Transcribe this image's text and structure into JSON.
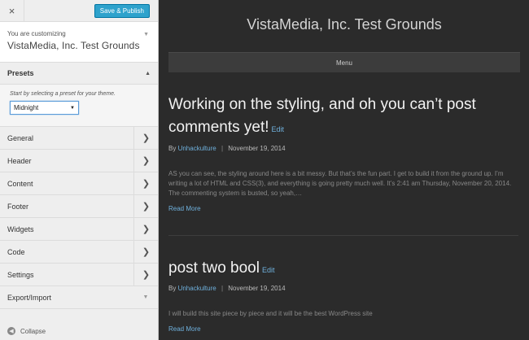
{
  "toolbar": {
    "close_icon": "×",
    "save_label": "Save & Publish"
  },
  "customizing": {
    "label": "You are customizing",
    "site_name": "VistaMedia, Inc. Test Grounds"
  },
  "presets": {
    "title": "Presets",
    "hint": "Start by selecting a preset for your theme.",
    "selected": "Midnight"
  },
  "sections": [
    {
      "label": "General"
    },
    {
      "label": "Header"
    },
    {
      "label": "Content"
    },
    {
      "label": "Footer"
    },
    {
      "label": "Widgets"
    },
    {
      "label": "Code"
    },
    {
      "label": "Settings"
    },
    {
      "label": "Export/Import"
    }
  ],
  "collapse_label": "Collapse",
  "preview": {
    "site_title": "VistaMedia, Inc. Test Grounds",
    "menu_label": "Menu",
    "posts": [
      {
        "title": "Working on the styling, and oh you can’t post comments yet!",
        "edit": "Edit",
        "by": "By",
        "author": "Unhackulture",
        "separator": "|",
        "date": "November 19, 2014",
        "excerpt": "AS you can see, the styling around here is a bit messy. But that’s the fun part. I get to build it from the ground up. I’m writing a lot of HTML and CSS(3), and everything is going pretty much well. It’s 2:41 am Thursday, November 20, 2014. The commenting system is busted, so yeah,…",
        "read_more": "Read More"
      },
      {
        "title": "post two bool",
        "edit": "Edit",
        "by": "By",
        "author": "Unhackulture",
        "separator": "|",
        "date": "November 19, 2014",
        "excerpt": "I will  build this site piece by piece and it will be the best  WordPress site",
        "read_more": "Read More"
      }
    ]
  },
  "colors": {
    "accent": "#2ea2cc",
    "link": "#6fb0dc",
    "preview_bg": "#2b2b2b"
  }
}
